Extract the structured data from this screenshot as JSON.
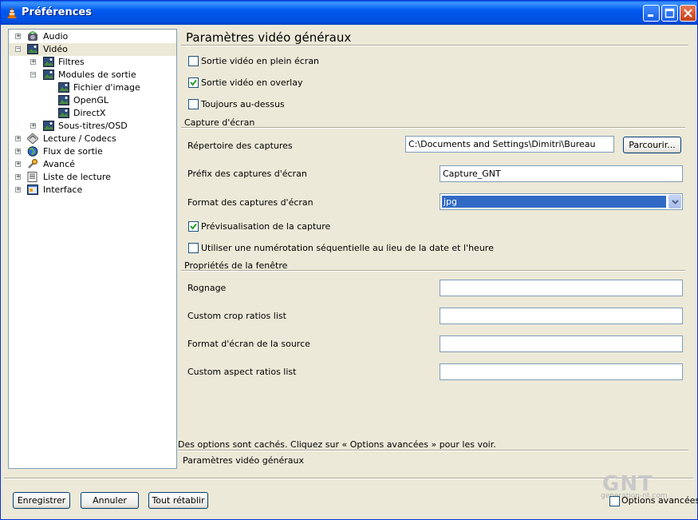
{
  "window": {
    "title": "Préférences"
  },
  "tree": {
    "items": [
      {
        "label": "Audio"
      },
      {
        "label": "Vidéo"
      },
      {
        "label": "Filtres"
      },
      {
        "label": "Modules de sortie"
      },
      {
        "label": "Fichier d'image"
      },
      {
        "label": "OpenGL"
      },
      {
        "label": "DirectX"
      },
      {
        "label": "Sous-titres/OSD"
      },
      {
        "label": "Lecture / Codecs"
      },
      {
        "label": "Flux de sortie"
      },
      {
        "label": "Avancé"
      },
      {
        "label": "Liste de lecture"
      },
      {
        "label": "Interface"
      }
    ]
  },
  "panel": {
    "heading": "Paramètres vidéo généraux",
    "fullscreen": {
      "label": "Sortie vidéo en plein écran",
      "checked": false
    },
    "overlay": {
      "label": "Sortie vidéo en overlay",
      "checked": true
    },
    "ontop": {
      "label": "Toujours au-dessus",
      "checked": false
    },
    "snapshot_section": "Capture d'écran",
    "snap_dir": {
      "label": "Répertoire des captures",
      "value": "C:\\Documents and Settings\\Dimitri\\Bureau",
      "button": "Parcourir..."
    },
    "snap_prefix": {
      "label": "Préfix des captures d'écran",
      "value": "Capture_GNT"
    },
    "snap_format": {
      "label": "Format des captures d'écran",
      "value": "jpg"
    },
    "snap_preview": {
      "label": "Prévisualisation de la capture",
      "checked": true
    },
    "snap_sequential": {
      "label": "Utiliser une numérotation séquentielle au lieu de la date et l'heure",
      "checked": false
    },
    "window_section": "Propriétés de la fenêtre",
    "crop": {
      "label": "Rognage",
      "value": ""
    },
    "crop_ratios": {
      "label": "Custom crop ratios list",
      "value": ""
    },
    "aspect": {
      "label": "Format d'écran de la source",
      "value": ""
    },
    "aspect_ratios": {
      "label": "Custom aspect ratios list",
      "value": ""
    },
    "hidden_note": "Des options sont cachés. Cliquez sur « Options avancées » pour les voir.",
    "footer_title": "Paramètres vidéo généraux"
  },
  "footer": {
    "save": "Enregistrer",
    "cancel": "Annuler",
    "reset": "Tout rétablir",
    "advanced": {
      "label": "Options avancées",
      "checked": false
    }
  },
  "watermark": {
    "logo": "GNT",
    "sub": "generation-nt.com"
  }
}
